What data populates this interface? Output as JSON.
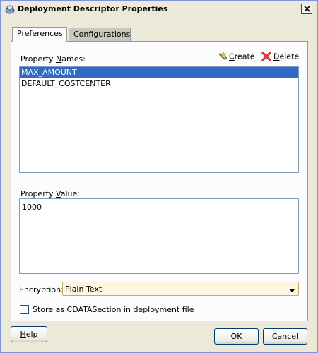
{
  "window": {
    "title": "Deployment Descriptor Properties",
    "icon": "oracle-jdeveloper-icon"
  },
  "tabs": [
    {
      "label": "Preferences",
      "selected": true
    },
    {
      "label": "Configurations",
      "selected": false
    }
  ],
  "property_names": {
    "label_pre": "Property ",
    "label_mnemonic": "N",
    "label_post": "ames:",
    "items": [
      "MAX_AMOUNT",
      "DEFAULT_COSTCENTER"
    ],
    "selected_index": 0
  },
  "toolbar": {
    "create_mnemonic": "C",
    "create_rest": "reate",
    "create_icon": "create-star-icon",
    "delete_mnemonic": "D",
    "delete_rest": "elete",
    "delete_icon": "red-x-delete-icon"
  },
  "property_value": {
    "label_pre": "Property ",
    "label_mnemonic": "V",
    "label_post": "alue:",
    "value": "1000"
  },
  "encryption": {
    "label": "Encryption:",
    "selected": "Plain Text"
  },
  "cdata": {
    "checked": false,
    "label_mnemonic": "S",
    "label_rest": "tore as CDATASection in deployment file"
  },
  "buttons": {
    "help_mnemonic": "H",
    "help_rest": "elp",
    "ok_mnemonic": "O",
    "ok_rest": "K",
    "cancel_mnemonic": "C",
    "cancel_rest": "ancel"
  },
  "colors": {
    "selection": "#316ac5",
    "dialog_bg": "#ece9d8",
    "combo_border": "#c9a86c"
  }
}
